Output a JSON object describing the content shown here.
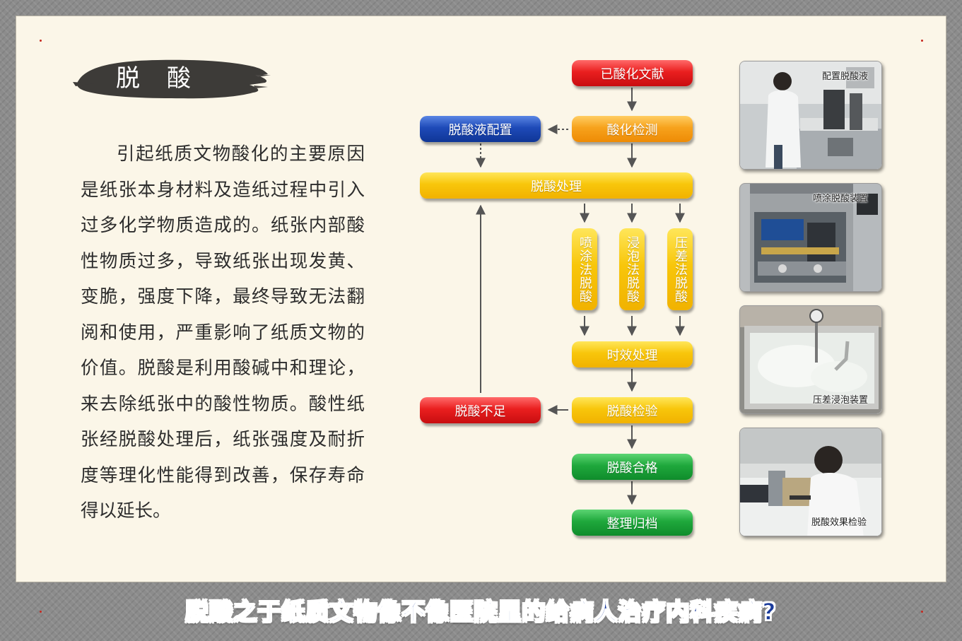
{
  "title": "脱　酸",
  "body_text": "引起纸质文物酸化的主要原因是纸张本身材料及造纸过程中引入过多化学物质造成的。纸张内部酸性物质过多，导致纸张出现发黄、变脆，强度下降，最终导致无法翻阅和使用，严重影响了纸质文物的价值。脱酸是利用酸碱中和理论，来去除纸张中的酸性物质。酸性纸张经脱酸处理后，纸张强度及耐折度等理化性能得到改善，保存寿命得以延长。",
  "flowchart": {
    "acidified_docs": "已酸化文献",
    "acid_test": "酸化检测",
    "solution_prep": "脱酸液配置",
    "deacid_process": "脱酸处理",
    "spray_method": "喷涂法脱酸",
    "immersion_method": "浸泡法脱酸",
    "pressure_method": "压差法脱酸",
    "aging": "时效处理",
    "deacid_inspection": "脱酸检验",
    "insufficient": "脱酸不足",
    "qualified": "脱酸合格",
    "archive": "整理归档"
  },
  "photos": [
    {
      "caption": "配置脱酸液"
    },
    {
      "caption": "喷涂脱酸装置"
    },
    {
      "caption": "压差浸泡装置"
    },
    {
      "caption": "脱酸效果检验"
    }
  ],
  "banner": "脱酸之于纸质文物像不像医院里的给病人治疗内科疾病?",
  "colors": {
    "red": "#e01b1f",
    "orange": "#f59a14",
    "yellow": "#f6c000",
    "blue": "#1a44ae",
    "green": "#1a9e37",
    "banner_blue": "#1b3c9c",
    "paper": "#fbf6e8"
  }
}
